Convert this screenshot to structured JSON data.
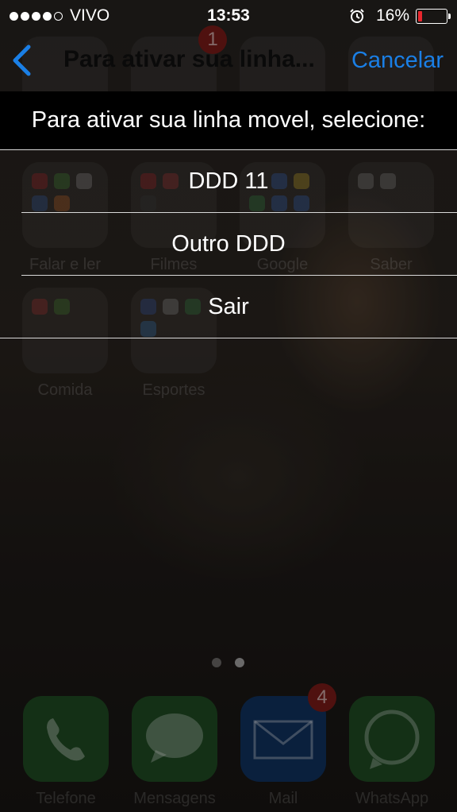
{
  "status_bar": {
    "carrier": "VIVO",
    "time": "13:53",
    "battery": "16%",
    "battery_level": 0.16,
    "signal_bars_filled": 4
  },
  "nav": {
    "title": "Para ativar sua linha...",
    "cancel_label": "Cancelar"
  },
  "menu": {
    "header": "Para ativar sua linha movel, selecione:",
    "options": [
      "DDD 11",
      "Outro DDD",
      "Sair"
    ]
  },
  "home_screen": {
    "folders": [
      {
        "label": "Falar e ler"
      },
      {
        "label": "Filmes"
      },
      {
        "label": "Google"
      },
      {
        "label": "Saber"
      },
      {
        "label": "Comida"
      },
      {
        "label": "Esportes"
      }
    ],
    "top_badge": "1",
    "dock": [
      {
        "label": "Telefone",
        "icon": "phone-icon"
      },
      {
        "label": "Mensagens",
        "icon": "speech-bubble-icon"
      },
      {
        "label": "Mail",
        "icon": "envelope-icon",
        "badge": "4"
      },
      {
        "label": "WhatsApp",
        "icon": "whatsapp-icon"
      }
    ]
  },
  "colors": {
    "accent": "#1a7fe6",
    "header_bg": "#000000",
    "battery_low": "#e8262d"
  }
}
